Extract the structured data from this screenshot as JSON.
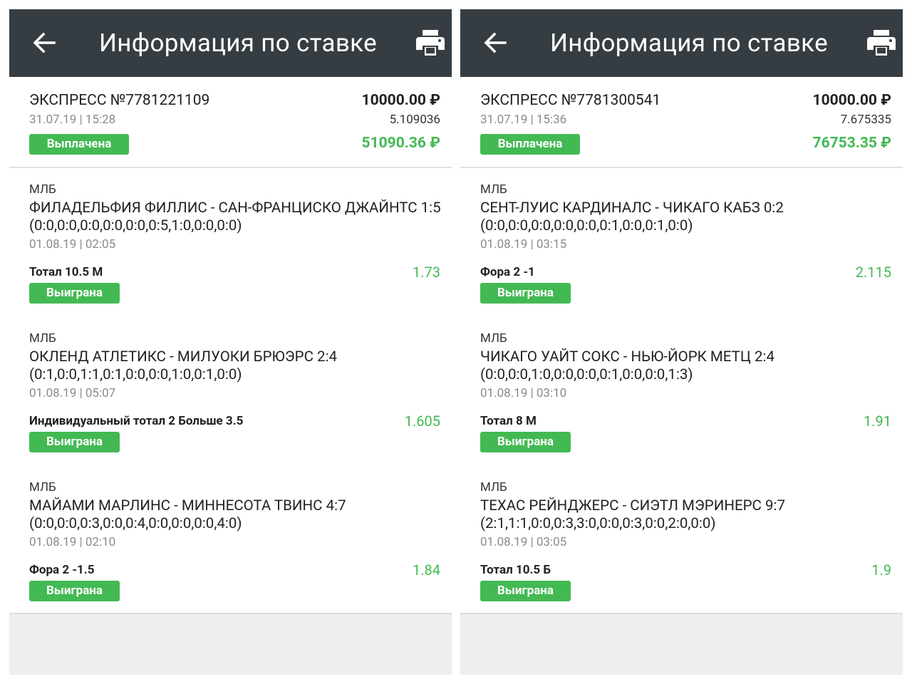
{
  "screens": [
    {
      "header": {
        "title": "Информация по ставке",
        "back_icon": "arrow-left-icon",
        "print_icon": "printer-icon"
      },
      "summary": {
        "bet_number": "ЭКСПРЕСС №7781221109",
        "date": "31.07.19 | 15:28",
        "stake": "10000.00 ₽",
        "total_coef": "5.109036",
        "status": "Выплачена",
        "payout": "51090.36 ₽"
      },
      "events": [
        {
          "league": "МЛБ",
          "match": "ФИЛАДЕЛЬФИЯ ФИЛЛИС - САН-ФРАНЦИСКО ДЖАЙНТС 1:5 (0:0,0:0,0:0,0:0,0:0,0:5,1:0,0:0,0:0)",
          "date": "01.08.19 | 02:05",
          "market": "Тотал 10.5 М",
          "odds": "1.73",
          "status": "Выиграна"
        },
        {
          "league": "МЛБ",
          "match": "ОКЛЕНД АТЛЕТИКС - МИЛУОКИ БРЮЭРС 2:4 (0:1,0:0,1:1,0:1,0:0,0:0,1:0,0:1,0:0)",
          "date": "01.08.19 | 05:07",
          "market": "Индивидуальный тотал 2 Больше 3.5",
          "odds": "1.605",
          "status": "Выиграна"
        },
        {
          "league": "МЛБ",
          "match": "МАЙАМИ МАРЛИНС - МИННЕСОТА ТВИНС 4:7 (0:0,0:0,0:3,0:0,0:4,0:0,0:0,0:0,4:0)",
          "date": "01.08.19 | 02:10",
          "market": "Фора 2 -1.5",
          "odds": "1.84",
          "status": "Выиграна"
        }
      ]
    },
    {
      "header": {
        "title": "Информация по ставке",
        "back_icon": "arrow-left-icon",
        "print_icon": "printer-icon"
      },
      "summary": {
        "bet_number": "ЭКСПРЕСС №7781300541",
        "date": "31.07.19 | 15:36",
        "stake": "10000.00 ₽",
        "total_coef": "7.675335",
        "status": "Выплачена",
        "payout": "76753.35 ₽"
      },
      "events": [
        {
          "league": "МЛБ",
          "match": "СЕНТ-ЛУИС КАРДИНАЛС - ЧИКАГО КАБЗ 0:2 (0:0,0:0,0:0,0:0,0:0,0:1,0:0,0:1,0:0)",
          "date": "01.08.19 | 03:15",
          "market": "Фора 2 -1",
          "odds": "2.115",
          "status": "Выиграна"
        },
        {
          "league": "МЛБ",
          "match": "ЧИКАГО УАЙТ СОКС - НЬЮ-ЙОРК МЕТЦ 2:4 (0:0,0:0,1:0,0:0,0:0,0:1,0:0,0:0,1:3)",
          "date": "01.08.19 | 03:10",
          "market": "Тотал 8 М",
          "odds": "1.91",
          "status": "Выиграна"
        },
        {
          "league": "МЛБ",
          "match": "ТЕХАС РЕЙНДЖЕРС - СИЭТЛ МЭРИНЕРС 9:7 (2:1,1:1,0:0,0:3,3:0,0:0,0:3,0:0,2:0,0:0)",
          "date": "01.08.19 | 03:05",
          "market": "Тотал 10.5 Б",
          "odds": "1.9",
          "status": "Выиграна"
        }
      ]
    }
  ],
  "colors": {
    "header_bg": "#363d42",
    "accent_green": "#43b953",
    "muted_text": "#8a8a8a",
    "footer_gray": "#efefef"
  }
}
